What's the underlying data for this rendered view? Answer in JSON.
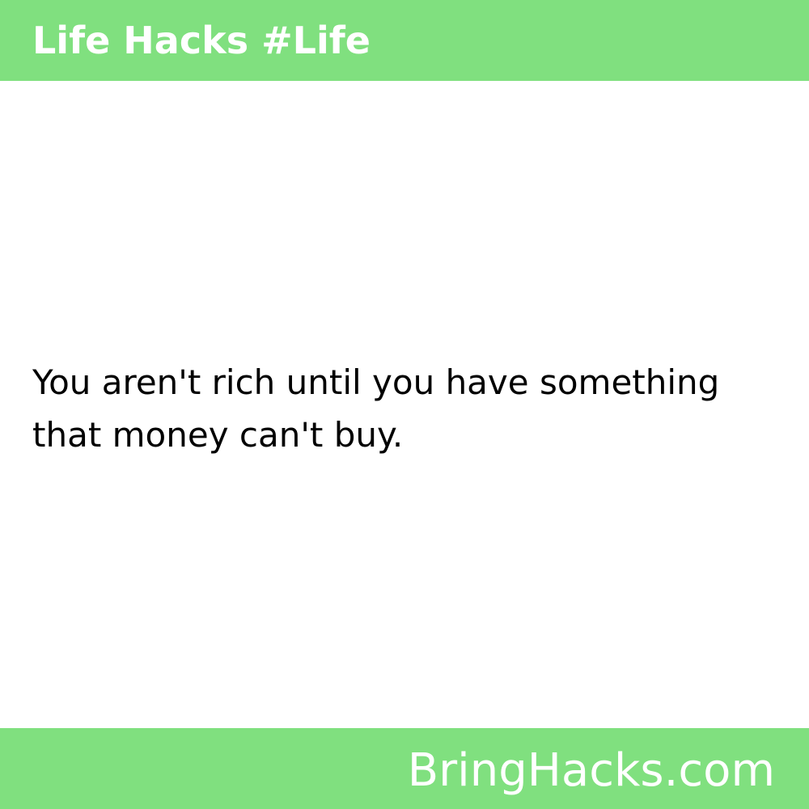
{
  "header": {
    "title": "Life Hacks #Life"
  },
  "content": {
    "quote_line1": "You aren't rich until you have something",
    "quote_line2": "that money can't buy."
  },
  "footer": {
    "site": "BringHacks.com"
  },
  "colors": {
    "bar_green": "#80e07f",
    "bar_text": "#ffffff",
    "body_text": "#000000",
    "background": "#ffffff"
  }
}
